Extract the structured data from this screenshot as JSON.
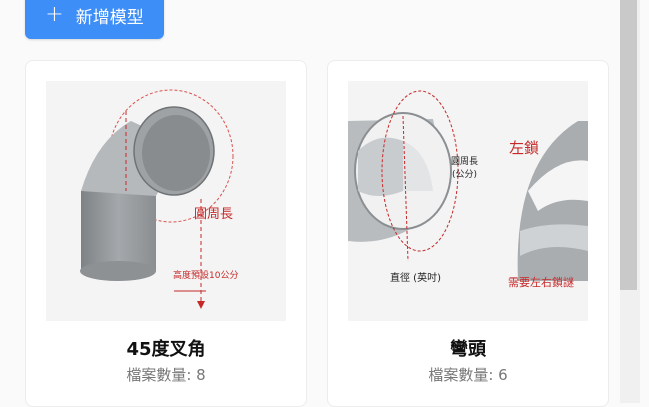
{
  "toolbar": {
    "add_label": "新增模型",
    "plus_glyph": "+"
  },
  "cards": [
    {
      "title": "45度叉角",
      "count_text": "檔案數量: 8",
      "image_labels": {
        "circumference": "圓周長",
        "height": "高度預設10公分"
      }
    },
    {
      "title": "彎頭",
      "count_text": "檔案數量: 6",
      "image_labels": {
        "circumference": "圓周長",
        "unit": "(公分)",
        "diameter": "直徑 (英吋)",
        "left_lock": "左鎖",
        "need_lock": "需要左右鎖謎"
      }
    }
  ],
  "colors": {
    "accent": "#3e8ef7",
    "annotation": "#c62828"
  }
}
